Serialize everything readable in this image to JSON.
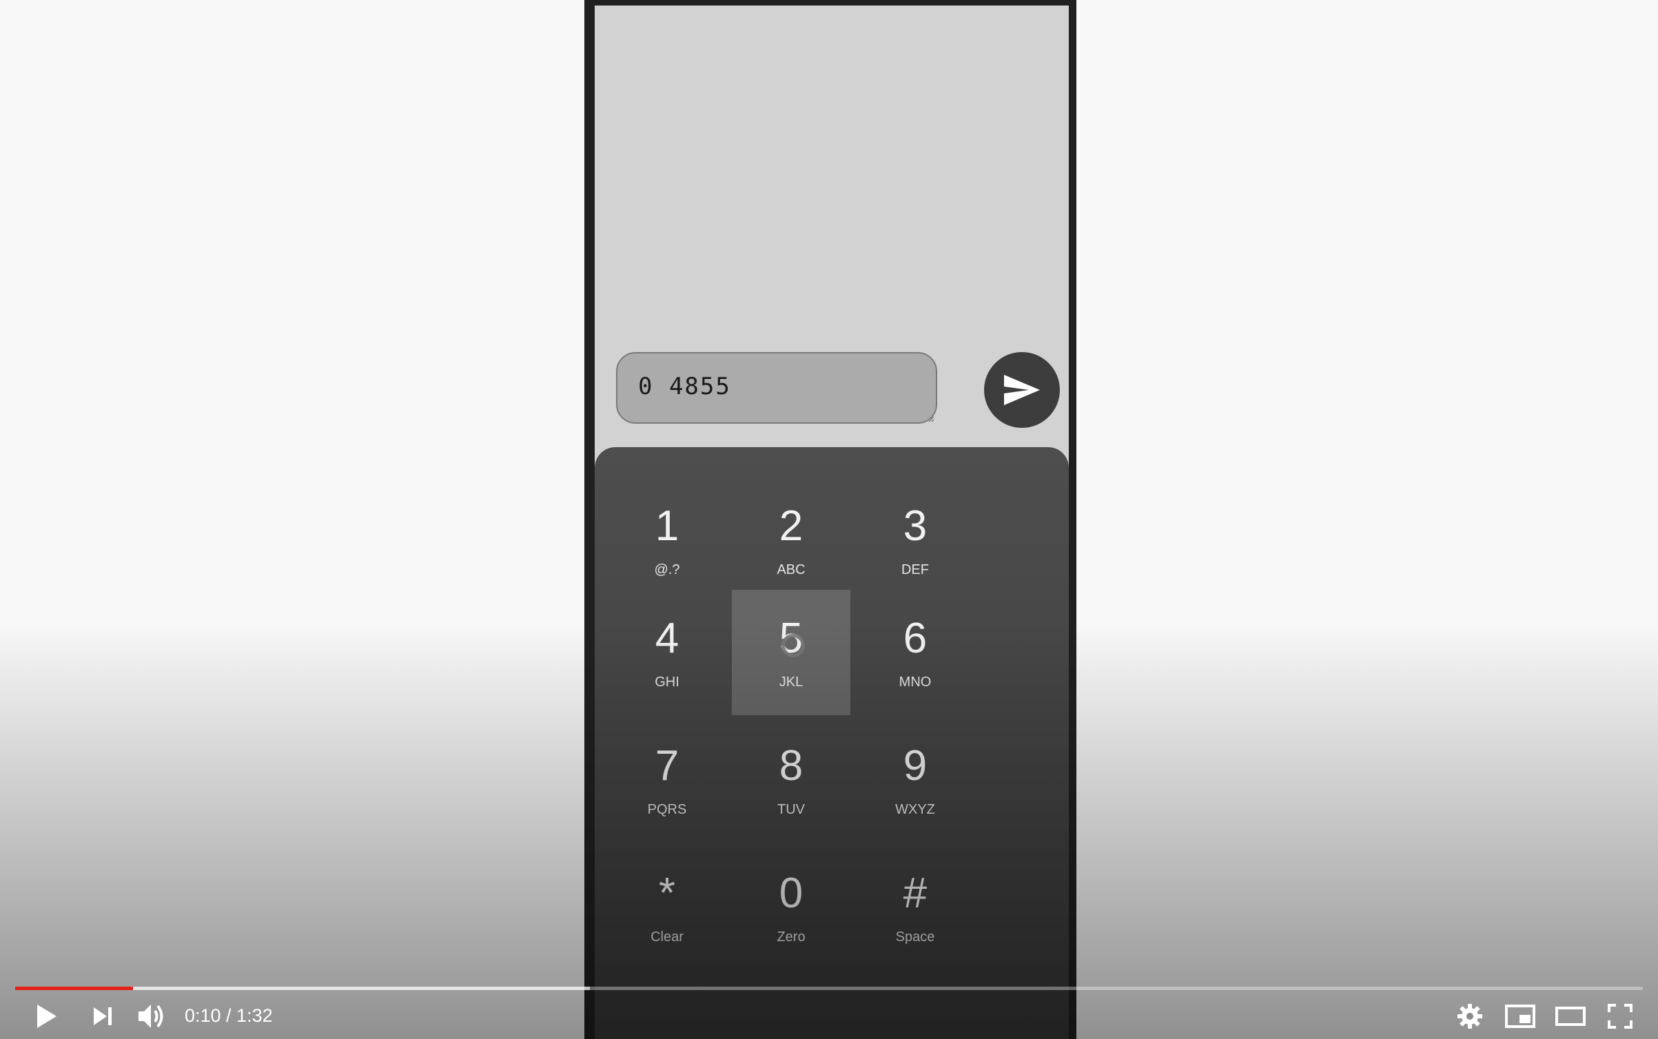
{
  "message": {
    "value": "0 4855"
  },
  "send_icon": "send-icon",
  "keypad": {
    "keys": [
      {
        "digit": "1",
        "letters": "@.?"
      },
      {
        "digit": "2",
        "letters": "ABC"
      },
      {
        "digit": "3",
        "letters": "DEF"
      },
      {
        "digit": "4",
        "letters": "GHI"
      },
      {
        "digit": "5",
        "letters": "JKL"
      },
      {
        "digit": "6",
        "letters": "MNO"
      },
      {
        "digit": "7",
        "letters": "PQRS"
      },
      {
        "digit": "8",
        "letters": "TUV"
      },
      {
        "digit": "9",
        "letters": "WXYZ"
      },
      {
        "digit": "*",
        "letters": "Clear"
      },
      {
        "digit": "0",
        "letters": "Zero"
      },
      {
        "digit": "#",
        "letters": "Space"
      }
    ],
    "pressed_key": "5"
  },
  "player": {
    "time_text": "0:10 / 1:32",
    "played_fraction": 0.0725,
    "buffered_fraction": 0.353,
    "progress_color": "#e62117",
    "controls": [
      "play-icon",
      "next-icon",
      "volume-icon",
      "settings-icon",
      "miniplayer-icon",
      "theater-icon",
      "fullscreen-icon"
    ]
  },
  "colors": {
    "phone_frame": "#202020",
    "screen_bg": "#d2d2d2",
    "keypad_bg": "#4e4e4e",
    "send_button_bg": "#3d3d3d"
  }
}
